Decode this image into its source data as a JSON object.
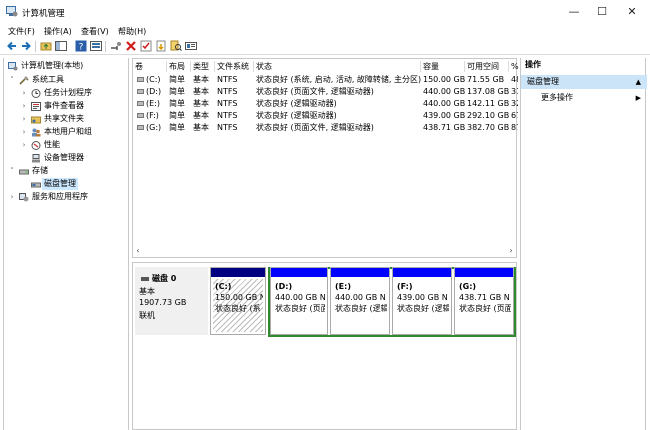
{
  "window": {
    "title": "计算机管理",
    "controls": {
      "minimize": "—",
      "maximize": "☐",
      "close": "✕"
    }
  },
  "menu": [
    "文件(F)",
    "操作(A)",
    "查看(V)",
    "帮助(H)"
  ],
  "toolbar": {
    "icons": [
      "back-icon",
      "forward-icon",
      "up-folder-icon",
      "show-hide-tree-icon",
      "help-icon",
      "properties-icon",
      "connect-icon",
      "delete-icon",
      "check-icon",
      "export-icon",
      "search-icon",
      "view-icon"
    ]
  },
  "tree": [
    {
      "label": "计算机管理(本地)",
      "level": 0,
      "arrow": "",
      "icon": "computer-management-icon"
    },
    {
      "label": "系统工具",
      "level": 1,
      "arrow": "˅",
      "icon": "tools-icon"
    },
    {
      "label": "任务计划程序",
      "level": 2,
      "arrow": "›",
      "icon": "clock-icon"
    },
    {
      "label": "事件查看器",
      "level": 2,
      "arrow": "›",
      "icon": "event-viewer-icon"
    },
    {
      "label": "共享文件夹",
      "level": 2,
      "arrow": "›",
      "icon": "shared-folder-icon"
    },
    {
      "label": "本地用户和组",
      "level": 2,
      "arrow": "›",
      "icon": "users-icon"
    },
    {
      "label": "性能",
      "level": 2,
      "arrow": "›",
      "icon": "performance-icon"
    },
    {
      "label": "设备管理器",
      "level": 2,
      "arrow": "",
      "icon": "device-manager-icon"
    },
    {
      "label": "存储",
      "level": 1,
      "arrow": "˅",
      "icon": "storage-icon"
    },
    {
      "label": "磁盘管理",
      "level": 2,
      "arrow": "",
      "icon": "disk-management-icon",
      "selected": true
    },
    {
      "label": "服务和应用程序",
      "level": 1,
      "arrow": "›",
      "icon": "services-icon"
    }
  ],
  "volumes": {
    "columns": [
      "卷",
      "布局",
      "类型",
      "文件系统",
      "状态",
      "容量",
      "可用空间",
      "%"
    ],
    "rows": [
      {
        "volume": "(C:)",
        "layout": "简单",
        "type": "基本",
        "fs": "NTFS",
        "status": "状态良好 (系统, 启动, 活动, 故障转储, 主分区)",
        "capacity": "150.00 GB",
        "free": "71.55 GB",
        "pct": "48"
      },
      {
        "volume": "(D:)",
        "layout": "简单",
        "type": "基本",
        "fs": "NTFS",
        "status": "状态良好 (页面文件, 逻辑驱动器)",
        "capacity": "440.00 GB",
        "free": "137.08 GB",
        "pct": "31"
      },
      {
        "volume": "(E:)",
        "layout": "简单",
        "type": "基本",
        "fs": "NTFS",
        "status": "状态良好 (逻辑驱动器)",
        "capacity": "440.00 GB",
        "free": "142.11 GB",
        "pct": "32"
      },
      {
        "volume": "(F:)",
        "layout": "简单",
        "type": "基本",
        "fs": "NTFS",
        "status": "状态良好 (逻辑驱动器)",
        "capacity": "439.00 GB",
        "free": "292.10 GB",
        "pct": "67"
      },
      {
        "volume": "(G:)",
        "layout": "简单",
        "type": "基本",
        "fs": "NTFS",
        "status": "状态良好 (页面文件, 逻辑驱动器)",
        "capacity": "438.71 GB",
        "free": "382.70 GB",
        "pct": "87"
      }
    ]
  },
  "disk": {
    "name": "磁盘 0",
    "type": "基本",
    "size": "1907.73 GB",
    "status": "联机",
    "partitions": [
      {
        "letter": "(C:)",
        "size": "150.00 GB N",
        "status": "状态良好 (系",
        "color": "#000080",
        "hatched": true
      },
      {
        "letter": "(D:)",
        "size": "440.00 GB N",
        "status": "状态良好 (页面",
        "color": "#0000ff",
        "hatched": false
      },
      {
        "letter": "(E:)",
        "size": "440.00 GB N",
        "status": "状态良好 (逻辑",
        "color": "#0000ff",
        "hatched": false
      },
      {
        "letter": "(F:)",
        "size": "439.00 GB N",
        "status": "状态良好 (逻辑",
        "color": "#0000ff",
        "hatched": false
      },
      {
        "letter": "(G:)",
        "size": "438.71 GB N",
        "status": "状态良好 (页面",
        "color": "#0000ff",
        "hatched": false
      }
    ],
    "extended_border_color": "#2f8a2f"
  },
  "actions": {
    "header": "操作",
    "section": "磁盘管理",
    "more": "更多操作"
  }
}
